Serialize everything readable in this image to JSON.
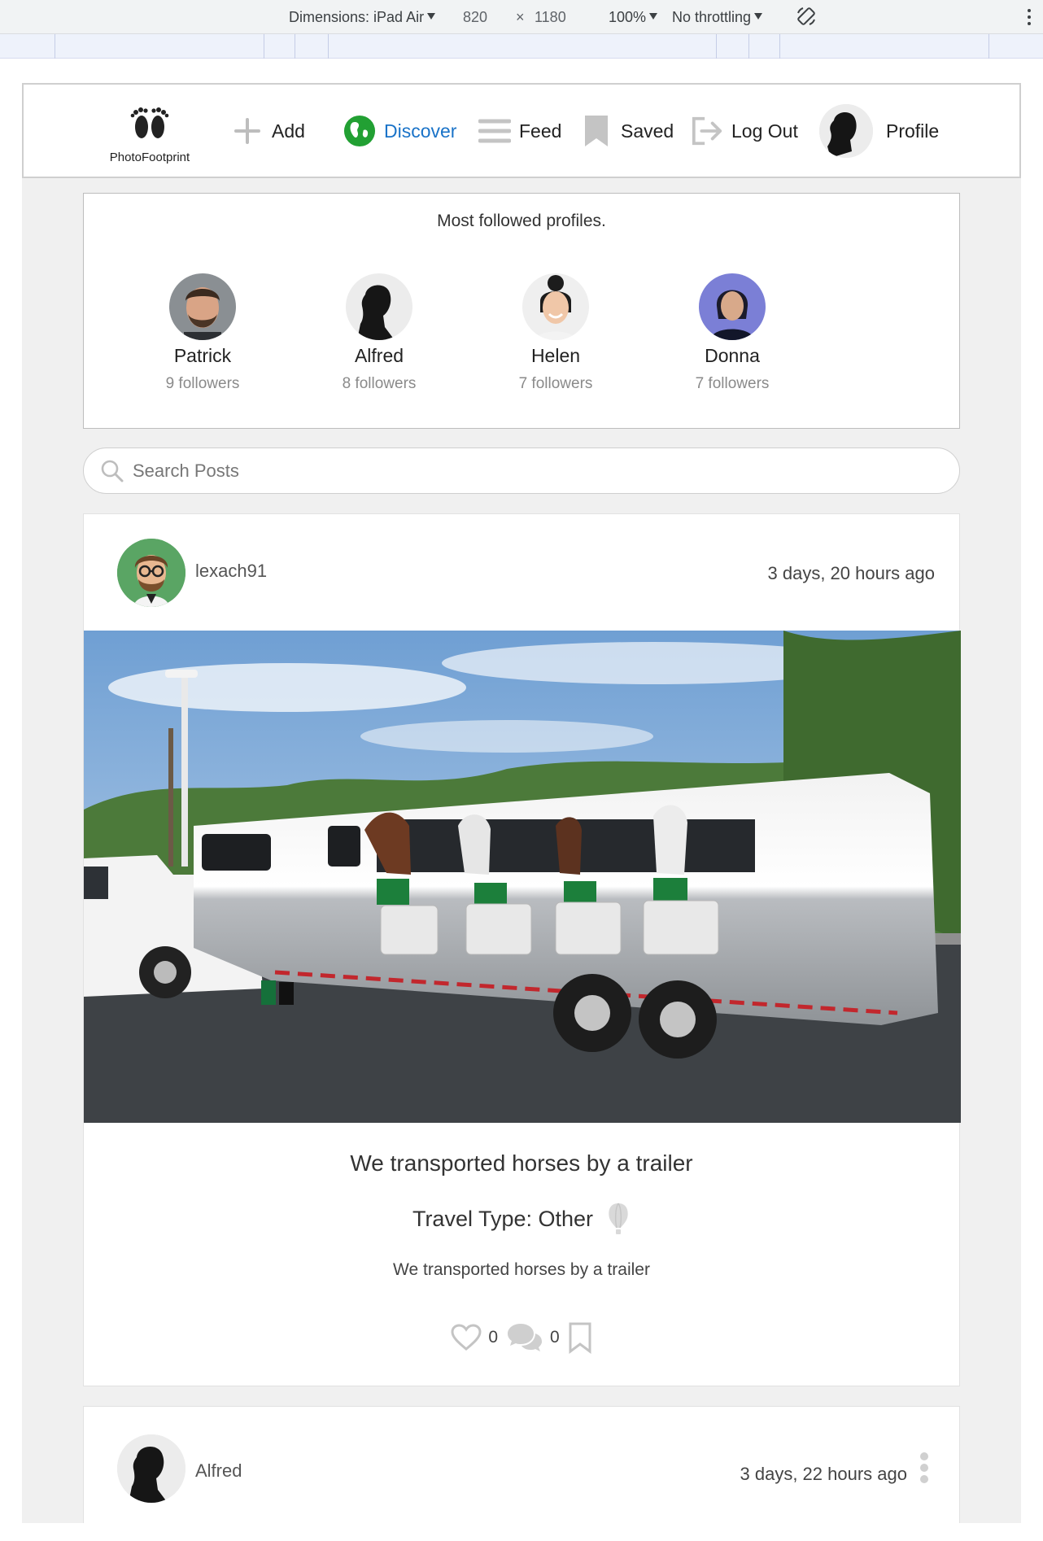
{
  "devtools": {
    "dimensions_label": "Dimensions: iPad Air",
    "width": "820",
    "times": "×",
    "height": "1180",
    "zoom": "100%",
    "throttle": "No throttling"
  },
  "nav": {
    "brand": "PhotoFootprint",
    "items": [
      {
        "label": "Add",
        "icon": "plus-icon"
      },
      {
        "label": "Discover",
        "icon": "globe-icon"
      },
      {
        "label": "Feed",
        "icon": "menu-icon"
      },
      {
        "label": "Saved",
        "icon": "bookmark-icon"
      },
      {
        "label": "Log Out",
        "icon": "logout-icon"
      },
      {
        "label": "Profile",
        "icon": "avatar"
      }
    ],
    "accent": "#1a73c8"
  },
  "most_followed": {
    "title": "Most followed profiles.",
    "profiles": [
      {
        "name": "Patrick",
        "followers": "9 followers"
      },
      {
        "name": "Alfred",
        "followers": "8 followers"
      },
      {
        "name": "Helen",
        "followers": "7 followers"
      },
      {
        "name": "Donna",
        "followers": "7 followers"
      }
    ]
  },
  "search": {
    "placeholder": "Search Posts",
    "value": ""
  },
  "posts": [
    {
      "user": "lexach91",
      "time": "3 days, 20 hours ago",
      "title": "We transported horses by a trailer",
      "travel_type": "Travel Type: Other",
      "description": "We transported horses by a trailer",
      "likes": "0",
      "comments": "0"
    },
    {
      "user": "Alfred",
      "time": "3 days, 22 hours ago"
    }
  ]
}
